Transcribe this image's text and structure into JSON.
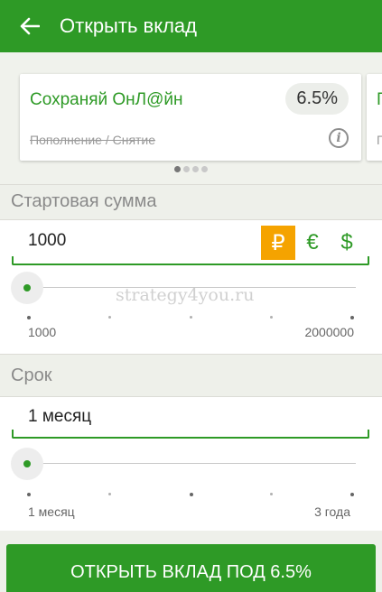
{
  "appbar": {
    "title": "Открыть вклад",
    "back_icon": "arrow-left-icon"
  },
  "carousel": {
    "cards": [
      {
        "name": "Сохраняй ОнЛ@йн",
        "rate": "6.5%",
        "subtitle": "Пополнение / Снятие"
      },
      {
        "name": "П",
        "subtitle": "П"
      }
    ],
    "dots_count": 4,
    "active_dot": 0
  },
  "start_amount": {
    "label": "Стартовая сумма",
    "value": "1000",
    "currencies": [
      {
        "symbol": "₽",
        "active": true
      },
      {
        "symbol": "€",
        "active": false
      },
      {
        "symbol": "$",
        "active": false
      }
    ],
    "slider": {
      "min_label": "1000",
      "max_label": "2000000",
      "position": 0
    }
  },
  "term": {
    "label": "Срок",
    "value": "1 месяц",
    "slider": {
      "min_label": "1 месяц",
      "max_label": "3 года",
      "position": 0
    }
  },
  "cta": {
    "label": "ОТКРЫТЬ ВКЛАД ПОД 6.5%"
  },
  "watermark": "strategy4you.ru",
  "colors": {
    "brand": "#2e9a26",
    "accent": "#f5a300",
    "muted": "#8a8a8a"
  }
}
